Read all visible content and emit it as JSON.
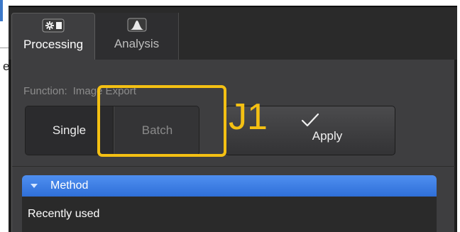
{
  "background_fragment": "e",
  "tabs": [
    {
      "label": "Processing",
      "icon": "gear-icon",
      "active": true
    },
    {
      "label": "Analysis",
      "icon": "histogram-icon",
      "active": false
    }
  ],
  "function": {
    "label": "Function:",
    "value": "Image Export"
  },
  "mode_toggle": {
    "options": [
      "Single",
      "Batch"
    ],
    "selected": "Single"
  },
  "apply_button": {
    "label": "Apply",
    "icon": "checkmark-icon"
  },
  "method_section": {
    "title": "Method",
    "expanded": true,
    "first_item": "Recently used"
  },
  "annotation": {
    "label": "J1",
    "color": "#f4c013"
  },
  "colors": {
    "accent": "#3b7fe8",
    "panel": "#3e3e40",
    "annotation": "#f4c013"
  }
}
